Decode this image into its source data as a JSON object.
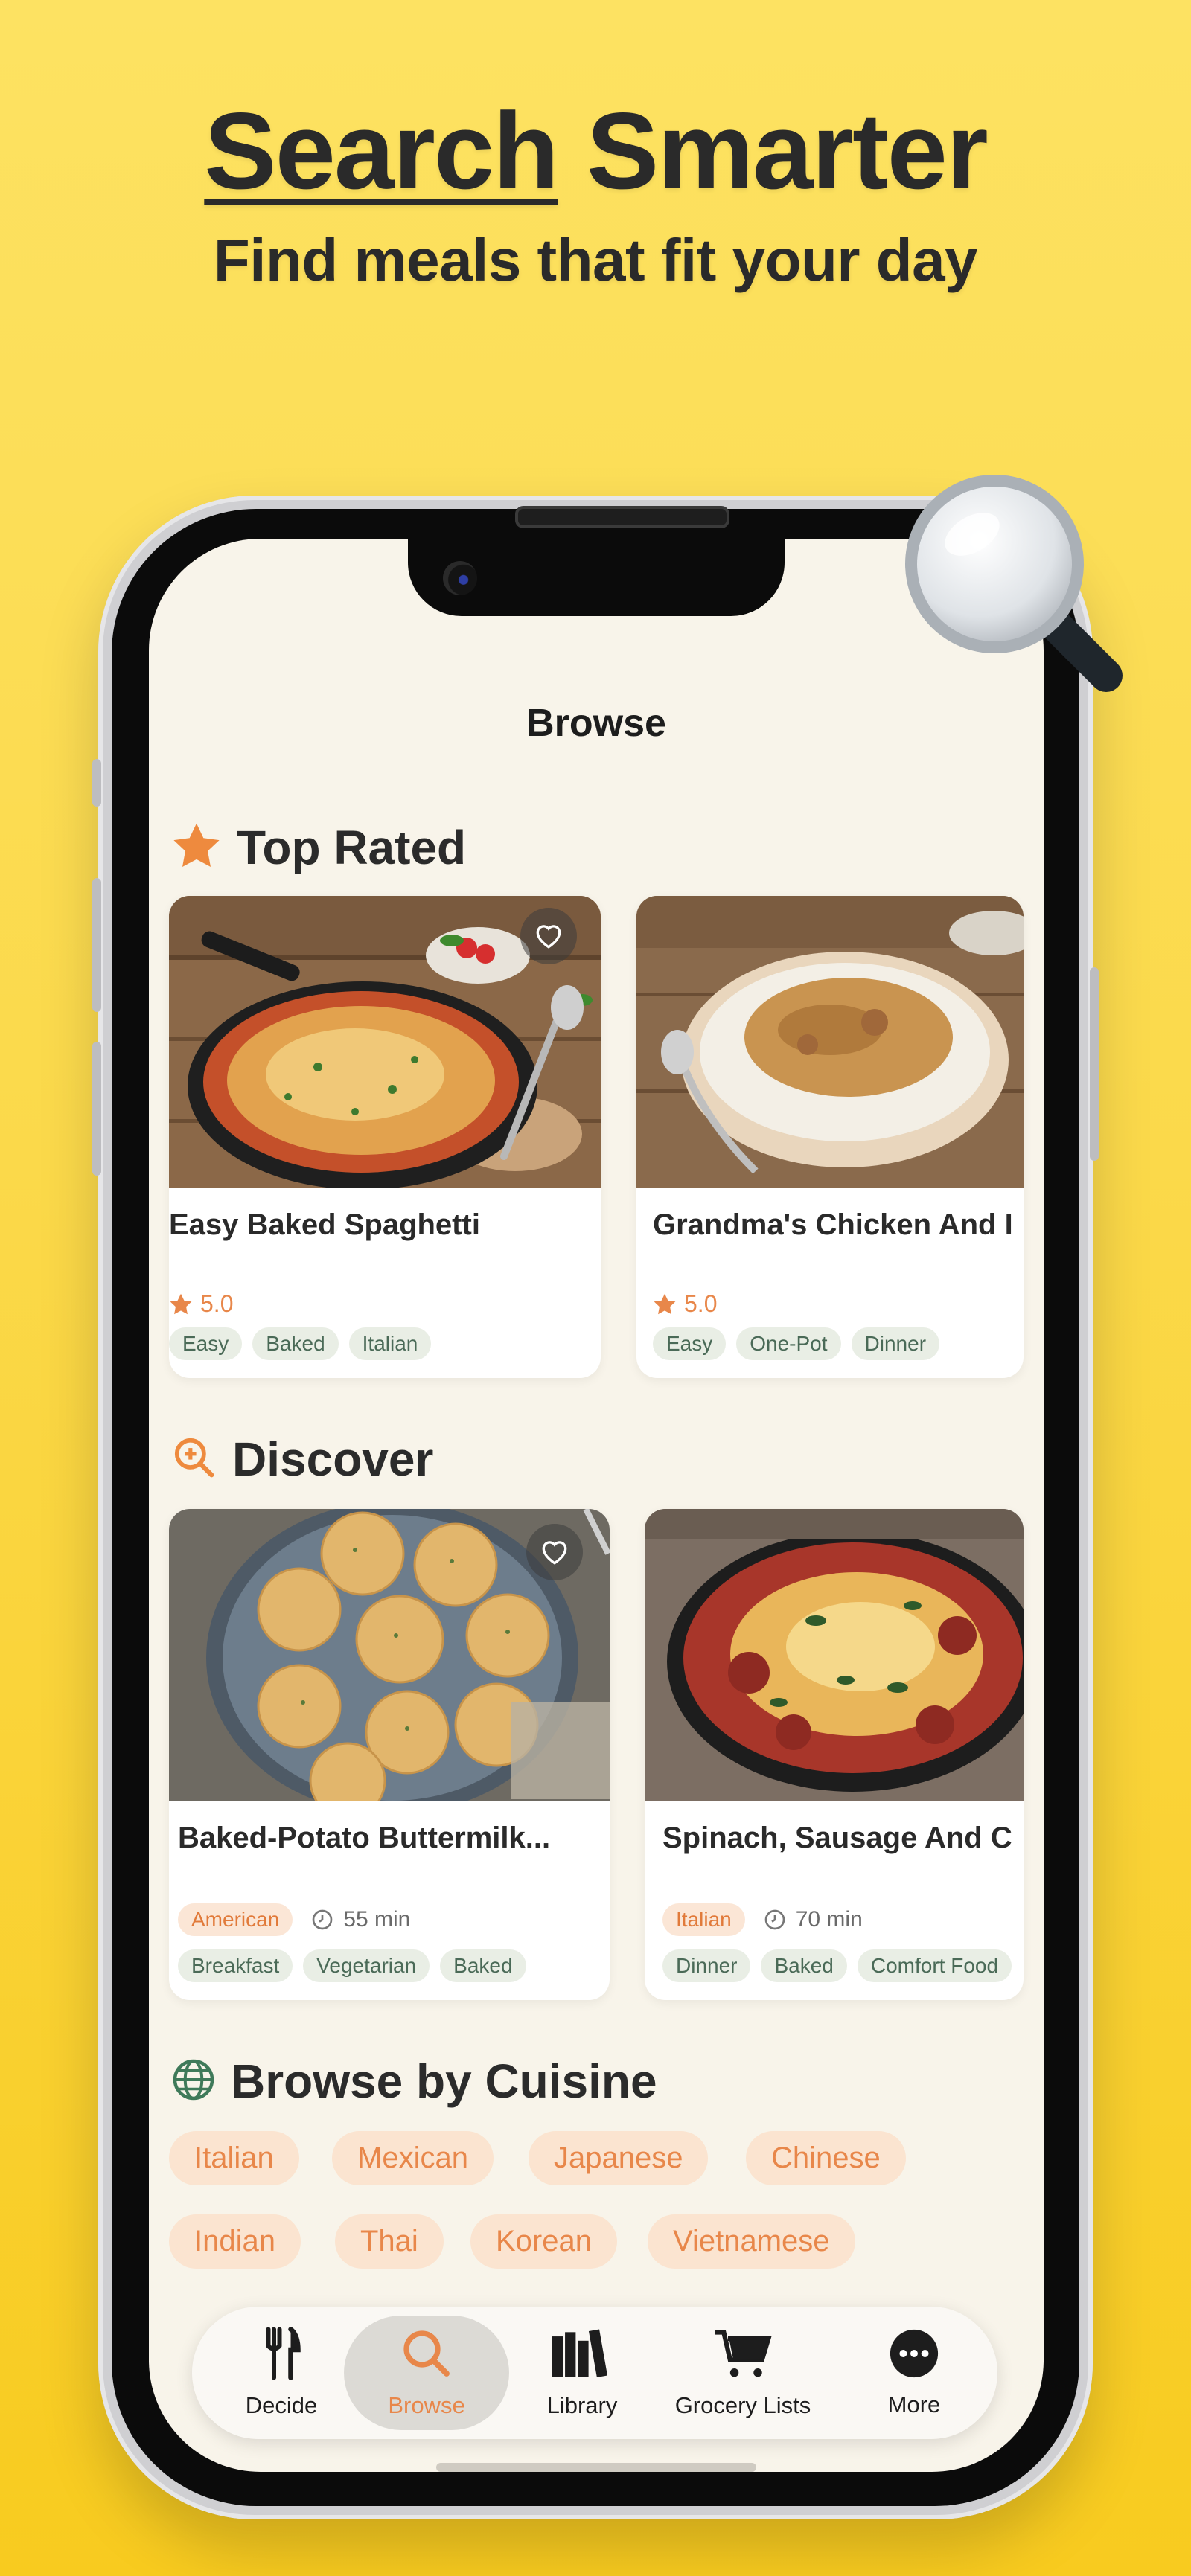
{
  "hero": {
    "title_underlined": "Search",
    "title_rest": " Smarter",
    "subtitle": "Find meals that fit your day"
  },
  "screen": {
    "title": "Browse"
  },
  "top_rated": {
    "heading": "Top Rated",
    "icon": "star-icon",
    "cards": [
      {
        "name": "Easy Baked Spaghetti",
        "rating": "5.0",
        "tags": [
          "Easy",
          "Baked",
          "Italian"
        ]
      },
      {
        "name": "Grandma's Chicken And I",
        "rating": "5.0",
        "tags": [
          "Easy",
          "One-Pot",
          "Dinner"
        ]
      }
    ]
  },
  "discover": {
    "heading": "Discover",
    "icon": "search-plus-icon",
    "cards": [
      {
        "name": "Baked-Potato Buttermilk...",
        "cuisine": "American",
        "time": "55 min",
        "tags": [
          "Breakfast",
          "Vegetarian",
          "Baked"
        ]
      },
      {
        "name": "Spinach, Sausage And C",
        "cuisine": "Italian",
        "time": "70 min",
        "tags": [
          "Dinner",
          "Baked",
          "Comfort Food"
        ]
      }
    ]
  },
  "cuisine": {
    "heading": "Browse by Cuisine",
    "icon": "globe-icon",
    "row1": [
      "Italian",
      "Mexican",
      "Japanese",
      "Chinese"
    ],
    "row2": [
      "Indian",
      "Thai",
      "Korean",
      "Vietnamese"
    ]
  },
  "tabbar": {
    "items": [
      {
        "label": "Decide",
        "icon": "fork-knife-icon"
      },
      {
        "label": "Browse",
        "icon": "search-icon",
        "active": true
      },
      {
        "label": "Library",
        "icon": "books-icon"
      },
      {
        "label": "Grocery Lists",
        "icon": "cart-icon"
      },
      {
        "label": "More",
        "icon": "more-icon"
      }
    ]
  },
  "colors": {
    "accent": "#e8874a",
    "background_top": "#fde262",
    "background_bottom": "#f8cb1f",
    "screen_bg": "#f8f4ea",
    "tag_green_text": "#4a6a57"
  }
}
